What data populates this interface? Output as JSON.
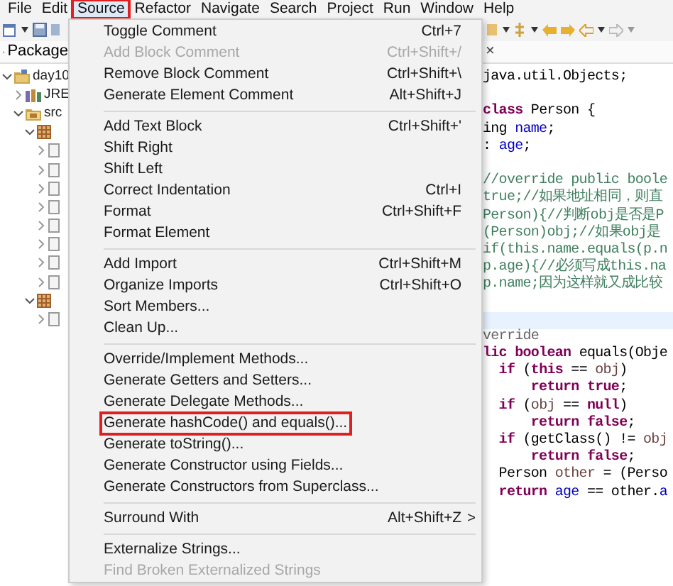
{
  "menubar": [
    {
      "label": "File",
      "outlined": false
    },
    {
      "label": "Edit",
      "outlined": false
    },
    {
      "label": "Source",
      "outlined": true
    },
    {
      "label": "Refactor",
      "outlined": false
    },
    {
      "label": "Navigate",
      "outlined": false
    },
    {
      "label": "Search",
      "outlined": false
    },
    {
      "label": "Project",
      "outlined": false
    },
    {
      "label": "Run",
      "outlined": false
    },
    {
      "label": "Window",
      "outlined": false
    },
    {
      "label": "Help",
      "outlined": false
    }
  ],
  "package_explorer": {
    "tab": "Package",
    "tree": [
      {
        "label": "day10",
        "kind": "project",
        "expanded": true,
        "children": [
          {
            "label": "JRE",
            "kind": "library",
            "expanded": false
          },
          {
            "label": "src",
            "kind": "folder",
            "expanded": true,
            "children": [
              {
                "kind": "package",
                "expanded": true,
                "children": [
                  {
                    "kind": "file",
                    "expanded": false
                  },
                  {
                    "kind": "file",
                    "expanded": false
                  },
                  {
                    "kind": "file",
                    "expanded": false
                  },
                  {
                    "kind": "file",
                    "expanded": false
                  },
                  {
                    "kind": "file",
                    "expanded": false
                  },
                  {
                    "kind": "file",
                    "expanded": false
                  },
                  {
                    "kind": "file",
                    "expanded": false
                  },
                  {
                    "kind": "file",
                    "expanded": false
                  }
                ]
              },
              {
                "kind": "package",
                "expanded": true,
                "children": [
                  {
                    "kind": "file",
                    "expanded": false
                  }
                ]
              }
            ]
          }
        ]
      }
    ]
  },
  "source_menu": [
    {
      "kind": "item",
      "label": "Toggle Comment",
      "shortcut": "Ctrl+7",
      "disabled": false,
      "outlined": false
    },
    {
      "kind": "item",
      "label": "Add Block Comment",
      "shortcut": "Ctrl+Shift+/",
      "disabled": true,
      "outlined": false
    },
    {
      "kind": "item",
      "label": "Remove Block Comment",
      "shortcut": "Ctrl+Shift+\\",
      "disabled": false,
      "outlined": false
    },
    {
      "kind": "item",
      "label": "Generate Element Comment",
      "shortcut": "Alt+Shift+J",
      "disabled": false,
      "outlined": false
    },
    {
      "kind": "separator"
    },
    {
      "kind": "item",
      "label": "Add Text Block",
      "shortcut": "Ctrl+Shift+'",
      "disabled": false,
      "outlined": false
    },
    {
      "kind": "item",
      "label": "Shift Right",
      "disabled": false,
      "outlined": false
    },
    {
      "kind": "item",
      "label": "Shift Left",
      "disabled": false,
      "outlined": false
    },
    {
      "kind": "item",
      "label": "Correct Indentation",
      "shortcut": "Ctrl+I",
      "disabled": false,
      "outlined": false
    },
    {
      "kind": "item",
      "label": "Format",
      "shortcut": "Ctrl+Shift+F",
      "disabled": false,
      "outlined": false
    },
    {
      "kind": "item",
      "label": "Format Element",
      "disabled": false,
      "outlined": false
    },
    {
      "kind": "separator"
    },
    {
      "kind": "item",
      "label": "Add Import",
      "shortcut": "Ctrl+Shift+M",
      "disabled": false,
      "outlined": false
    },
    {
      "kind": "item",
      "label": "Organize Imports",
      "shortcut": "Ctrl+Shift+O",
      "disabled": false,
      "outlined": false
    },
    {
      "kind": "item",
      "label": "Sort Members...",
      "disabled": false,
      "outlined": false
    },
    {
      "kind": "item",
      "label": "Clean Up...",
      "disabled": false,
      "outlined": false
    },
    {
      "kind": "separator"
    },
    {
      "kind": "item",
      "label": "Override/Implement Methods...",
      "disabled": false,
      "outlined": false
    },
    {
      "kind": "item",
      "label": "Generate Getters and Setters...",
      "disabled": false,
      "outlined": false
    },
    {
      "kind": "item",
      "label": "Generate Delegate Methods...",
      "disabled": false,
      "outlined": false
    },
    {
      "kind": "item",
      "label": "Generate hashCode() and equals()...",
      "disabled": false,
      "outlined": true
    },
    {
      "kind": "item",
      "label": "Generate toString()...",
      "disabled": false,
      "outlined": false
    },
    {
      "kind": "item",
      "label": "Generate Constructor using Fields...",
      "disabled": false,
      "outlined": false
    },
    {
      "kind": "item",
      "label": "Generate Constructors from Superclass...",
      "disabled": false,
      "outlined": false
    },
    {
      "kind": "separator"
    },
    {
      "kind": "item",
      "label": "Surround With",
      "shortcut": "Alt+Shift+Z",
      "submenu": ">",
      "disabled": false,
      "outlined": false
    },
    {
      "kind": "separator"
    },
    {
      "kind": "item",
      "label": "Externalize Strings...",
      "disabled": false,
      "outlined": false
    },
    {
      "kind": "item",
      "label": "Find Broken Externalized Strings",
      "disabled": true,
      "outlined": false
    }
  ],
  "editor": {
    "tab_close": "×",
    "lines": [
      {
        "current": false,
        "segments": [
          {
            "kind": "plain",
            "text": "java.util.Objects;"
          }
        ]
      },
      {
        "current": false
      },
      {
        "current": false,
        "segments": [
          {
            "kind": "keyword",
            "text": "class"
          },
          {
            "kind": "plain",
            "text": " Person {"
          }
        ]
      },
      {
        "current": false,
        "segments": [
          {
            "kind": "plain",
            "text": "ing "
          },
          {
            "kind": "field",
            "text": "name"
          },
          {
            "kind": "plain",
            "text": ";"
          }
        ]
      },
      {
        "current": false,
        "segments": [
          {
            "kind": "plain",
            "text": ": "
          },
          {
            "kind": "field",
            "text": "age"
          },
          {
            "kind": "plain",
            "text": ";"
          }
        ]
      },
      {
        "current": false
      },
      {
        "current": false,
        "segments": [
          {
            "kind": "comment",
            "text": "//override public boole"
          }
        ]
      },
      {
        "current": false,
        "segments": [
          {
            "kind": "comment",
            "text": "true;//如果地址相同，则直"
          }
        ]
      },
      {
        "current": false,
        "segments": [
          {
            "kind": "comment",
            "text": "Person){//判断obj是否是P"
          }
        ]
      },
      {
        "current": false,
        "segments": [
          {
            "kind": "comment",
            "text": "(Person)obj;//如果obj是"
          }
        ]
      },
      {
        "current": false,
        "segments": [
          {
            "kind": "comment",
            "text": "if(this.name.equals(p.n"
          }
        ]
      },
      {
        "current": false,
        "segments": [
          {
            "kind": "comment",
            "text": "p.age){//必须写成this.na"
          }
        ]
      },
      {
        "current": false,
        "segments": [
          {
            "kind": "comment",
            "text": "p.name;因为这样就又成比较"
          }
        ]
      },
      {
        "current": false
      },
      {
        "current": true
      },
      {
        "current": false,
        "segments": [
          {
            "kind": "annotation",
            "text": "verride"
          }
        ]
      },
      {
        "current": false,
        "segments": [
          {
            "kind": "keyword",
            "text": "lic boolean"
          },
          {
            "kind": "plain",
            "text": " equals(Obje"
          }
        ]
      },
      {
        "current": false,
        "segments": [
          {
            "kind": "keyword",
            "text": "  if"
          },
          {
            "kind": "plain",
            "text": " ("
          },
          {
            "kind": "keyword",
            "text": "this"
          },
          {
            "kind": "plain",
            "text": " == "
          },
          {
            "kind": "local",
            "text": "obj"
          },
          {
            "kind": "plain",
            "text": ")"
          }
        ]
      },
      {
        "current": false,
        "segments": [
          {
            "kind": "keyword",
            "text": "      return true"
          },
          {
            "kind": "plain",
            "text": ";"
          }
        ]
      },
      {
        "current": false,
        "segments": [
          {
            "kind": "keyword",
            "text": "  if"
          },
          {
            "kind": "plain",
            "text": " ("
          },
          {
            "kind": "local",
            "text": "obj"
          },
          {
            "kind": "plain",
            "text": " == "
          },
          {
            "kind": "keyword",
            "text": "null"
          },
          {
            "kind": "plain",
            "text": ")"
          }
        ]
      },
      {
        "current": false,
        "segments": [
          {
            "kind": "keyword",
            "text": "      return false"
          },
          {
            "kind": "plain",
            "text": ";"
          }
        ]
      },
      {
        "current": false,
        "segments": [
          {
            "kind": "keyword",
            "text": "  if"
          },
          {
            "kind": "plain",
            "text": " (getClass() != "
          },
          {
            "kind": "local",
            "text": "obj"
          }
        ]
      },
      {
        "current": false,
        "segments": [
          {
            "kind": "keyword",
            "text": "      return false"
          },
          {
            "kind": "plain",
            "text": ";"
          }
        ]
      },
      {
        "current": false,
        "segments": [
          {
            "kind": "plain",
            "text": "  Person "
          },
          {
            "kind": "local",
            "text": "other"
          },
          {
            "kind": "plain",
            "text": " = (Perso"
          }
        ]
      },
      {
        "current": false,
        "segments": [
          {
            "kind": "keyword",
            "text": "  return"
          },
          {
            "kind": "field",
            "text": " age"
          },
          {
            "kind": "plain",
            "text": " == other."
          },
          {
            "kind": "field",
            "text": "a"
          }
        ]
      }
    ]
  }
}
